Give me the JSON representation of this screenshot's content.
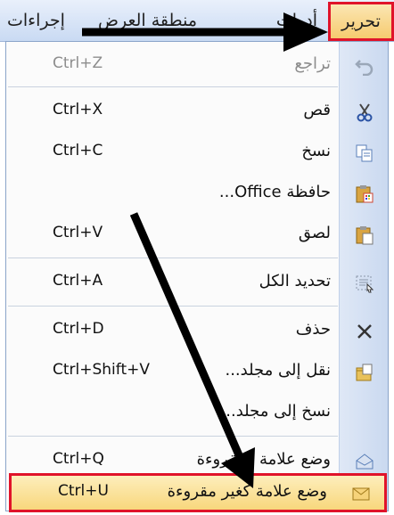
{
  "menubar": {
    "edit": "تحرير",
    "tools": "أدوات",
    "actions": "إجراءات",
    "hidden": "منطقة العرض"
  },
  "menu": {
    "items": [
      {
        "label": "تراجع",
        "shortcut": "Ctrl+Z",
        "icon": "undo-icon",
        "disabled": true
      },
      {
        "label": "قص",
        "shortcut": "Ctrl+X",
        "icon": "scissors-icon"
      },
      {
        "label": "نسخ",
        "shortcut": "Ctrl+C",
        "icon": "copy-icon"
      },
      {
        "label": "حافظة Office...",
        "shortcut": "",
        "icon": "clipboard-icon"
      },
      {
        "label": "لصق",
        "shortcut": "Ctrl+V",
        "icon": "paste-icon"
      },
      {
        "label": "تحديد الكل",
        "shortcut": "Ctrl+A",
        "icon": "select-all-icon"
      },
      {
        "label": "حذف",
        "shortcut": "Ctrl+D",
        "icon": "delete-icon"
      },
      {
        "label": "نقل إلى مجلد...",
        "shortcut": "Ctrl+Shift+V",
        "icon": "move-folder-icon"
      },
      {
        "label": "نسخ إلى مجلد...",
        "shortcut": "",
        "icon": "copy-folder-icon"
      },
      {
        "label": "وضع علامة كمقروءة",
        "shortcut": "Ctrl+Q",
        "icon": "mark-read-icon"
      },
      {
        "label": "وضع علامة كغير مقروءة",
        "shortcut": "Ctrl+U",
        "icon": "mark-unread-icon",
        "highlighted": true
      }
    ]
  },
  "colors": {
    "highlight_border": "#e0132a",
    "arrow": "#000000"
  }
}
